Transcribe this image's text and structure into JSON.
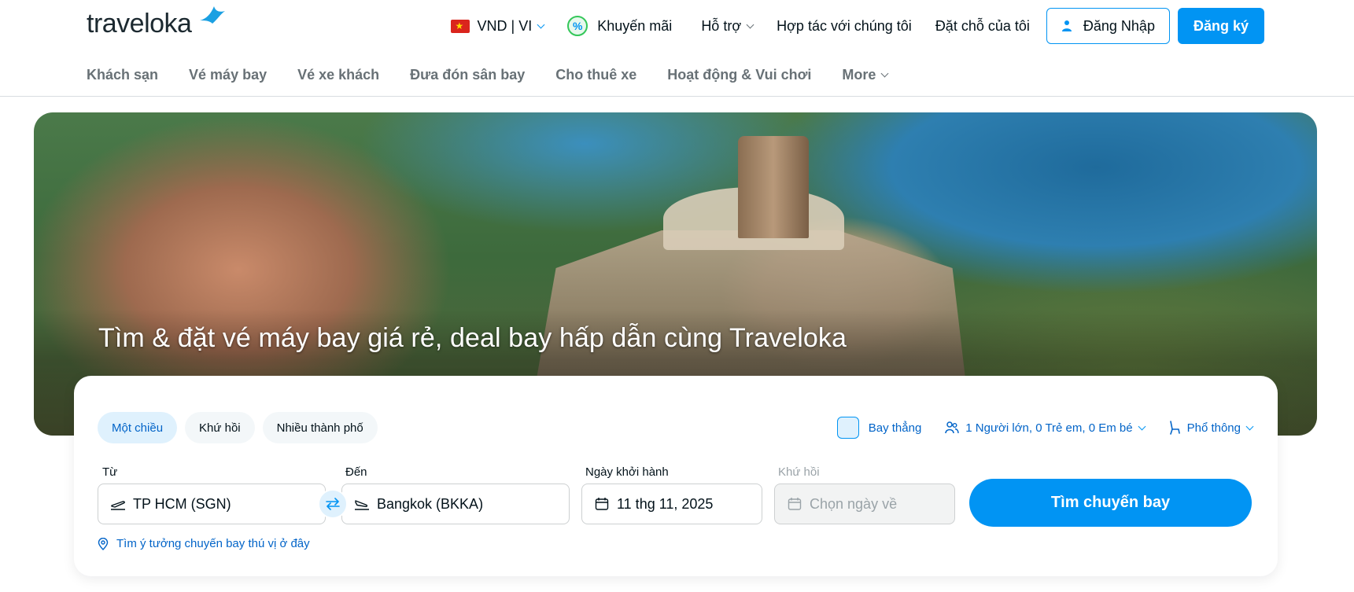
{
  "brand": {
    "logo_text": "traveloka"
  },
  "topnav": {
    "currency": "VND | VI",
    "promo": "Khuyến mãi",
    "support": "Hỗ trợ",
    "partner": "Hợp tác với chúng tôi",
    "bookings": "Đặt chỗ của tôi",
    "login": "Đăng Nhập",
    "signup": "Đăng ký"
  },
  "subnav": {
    "items": [
      "Khách sạn",
      "Vé máy bay",
      "Vé xe khách",
      "Đưa đón sân bay",
      "Cho thuê xe",
      "Hoạt động & Vui chơi"
    ],
    "more": "More"
  },
  "hero": {
    "title": "Tìm & đặt vé máy bay giá rẻ, deal bay hấp dẫn cùng Traveloka"
  },
  "search": {
    "trip_types": [
      "Một chiều",
      "Khứ hồi",
      "Nhiều thành phố"
    ],
    "active_trip_type": "Một chiều",
    "direct_flight": "Bay thẳng",
    "direct_flight_checked": false,
    "passengers": "1 Người lớn, 0 Trẻ em, 0 Em bé",
    "cabin_class": "Phổ thông",
    "from_label": "Từ",
    "from_value": "TP HCM (SGN)",
    "to_label": "Đến",
    "to_value": "Bangkok (BKKA)",
    "depart_label": "Ngày khởi hành",
    "depart_value": "11 thg 11, 2025",
    "return_label": "Khứ hồi",
    "return_placeholder": "Chọn ngày về",
    "submit": "Tìm chuyến bay",
    "idea_link": "Tìm ý tưởng chuyến bay thú vị ở đây"
  },
  "colors": {
    "primary": "#0194f3",
    "primary_text": "#0264c8",
    "muted": "#687176"
  }
}
